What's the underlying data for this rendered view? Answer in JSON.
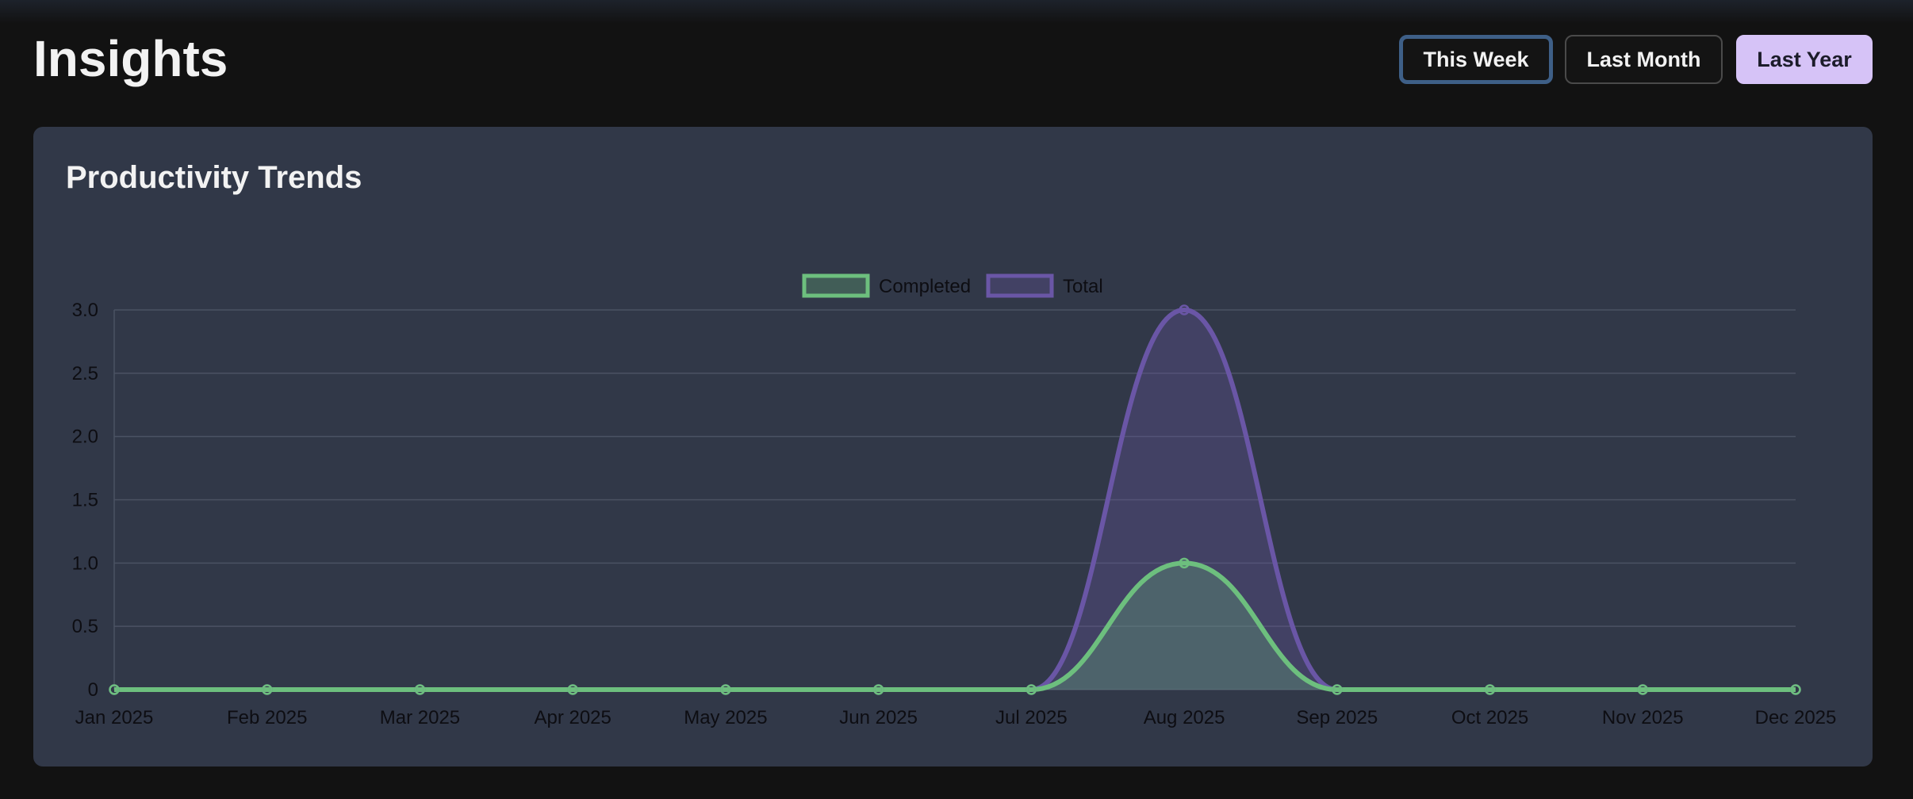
{
  "header": {
    "title": "Insights"
  },
  "range_buttons": {
    "this_week": "This Week",
    "last_month": "Last Month",
    "last_year": "Last Year",
    "selected": "Last Year"
  },
  "card": {
    "title": "Productivity Trends"
  },
  "colors": {
    "completed": "#6dbf7e",
    "total": "#6a56a6",
    "active_button": "#d6c3f7"
  },
  "chart_data": {
    "type": "line",
    "categories": [
      "Jan 2025",
      "Feb 2025",
      "Mar 2025",
      "Apr 2025",
      "May 2025",
      "Jun 2025",
      "Jul 2025",
      "Aug 2025",
      "Sep 2025",
      "Oct 2025",
      "Nov 2025",
      "Dec 2025"
    ],
    "series": [
      {
        "name": "Completed",
        "values": [
          0,
          0,
          0,
          0,
          0,
          0,
          0,
          1,
          0,
          0,
          0,
          0
        ]
      },
      {
        "name": "Total",
        "values": [
          0,
          0,
          0,
          0,
          0,
          0,
          0,
          3,
          0,
          0,
          0,
          0
        ]
      }
    ],
    "yticks": [
      "0",
      "0.5",
      "1.0",
      "1.5",
      "2.0",
      "2.5",
      "3.0"
    ],
    "ylim": [
      0,
      3
    ],
    "fill": true,
    "smooth": true,
    "grid": true,
    "legend": "top-center"
  }
}
